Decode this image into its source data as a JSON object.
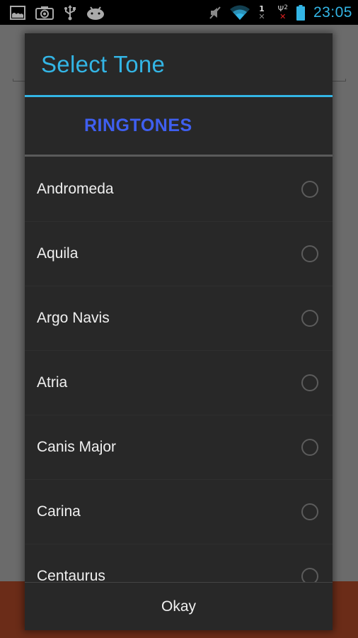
{
  "status_bar": {
    "left_icons": [
      "gallery-icon",
      "screenshot-camera-icon",
      "usb-icon",
      "android-icon"
    ],
    "right_icons": [
      "mute-icon",
      "wifi-icon",
      "sim1-no-signal-icon",
      "sim2-no-signal-icon",
      "battery-icon"
    ],
    "sim1_label": "1",
    "sim2_label": "2",
    "time": "23:05",
    "accent_color": "#33b5e5"
  },
  "dialog": {
    "title": "Select Tone",
    "section_header": "RINGTONES",
    "items": [
      {
        "label": "Andromeda",
        "selected": false
      },
      {
        "label": "Aquila",
        "selected": false
      },
      {
        "label": "Argo Navis",
        "selected": false
      },
      {
        "label": "Atria",
        "selected": false
      },
      {
        "label": "Canis Major",
        "selected": false
      },
      {
        "label": "Carina",
        "selected": false
      },
      {
        "label": "Centaurus",
        "selected": false
      }
    ],
    "confirm_label": "Okay"
  },
  "colors": {
    "title": "#33b5e5",
    "section_header": "#3f5ff0",
    "dialog_bg": "#282828",
    "backdrop": "#6b6b6b",
    "footer": "#6b2c18"
  }
}
